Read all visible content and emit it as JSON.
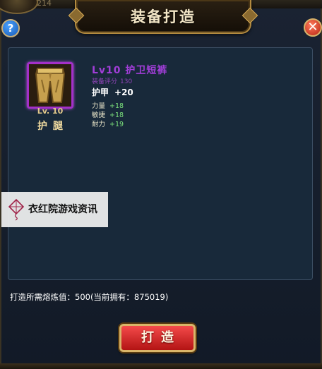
{
  "window": {
    "title": "装备打造",
    "corner_text": "214",
    "help_label": "?",
    "close_label": "✕"
  },
  "item": {
    "icon": "golden-trousers-icon",
    "level_badge": "Lv. 10",
    "slot": "护腿",
    "name": "Lv10 护卫短裤",
    "score_label": "装备评分",
    "score_value": "130",
    "main_stat": {
      "label": "护甲",
      "value": "+20"
    },
    "sub_stats": [
      {
        "label": "力量",
        "value": "+18"
      },
      {
        "label": "敏捷",
        "value": "+18"
      },
      {
        "label": "耐力",
        "value": "+19"
      }
    ],
    "rarity_color": "#a13ed8"
  },
  "watermark": {
    "icon": "kite-icon",
    "text": "衣红院游戏资讯"
  },
  "cost": {
    "text": "打造所需熔炼值：500(当前拥有：875019)"
  },
  "forge_button": {
    "label": "打造",
    "color": "#d42222"
  }
}
